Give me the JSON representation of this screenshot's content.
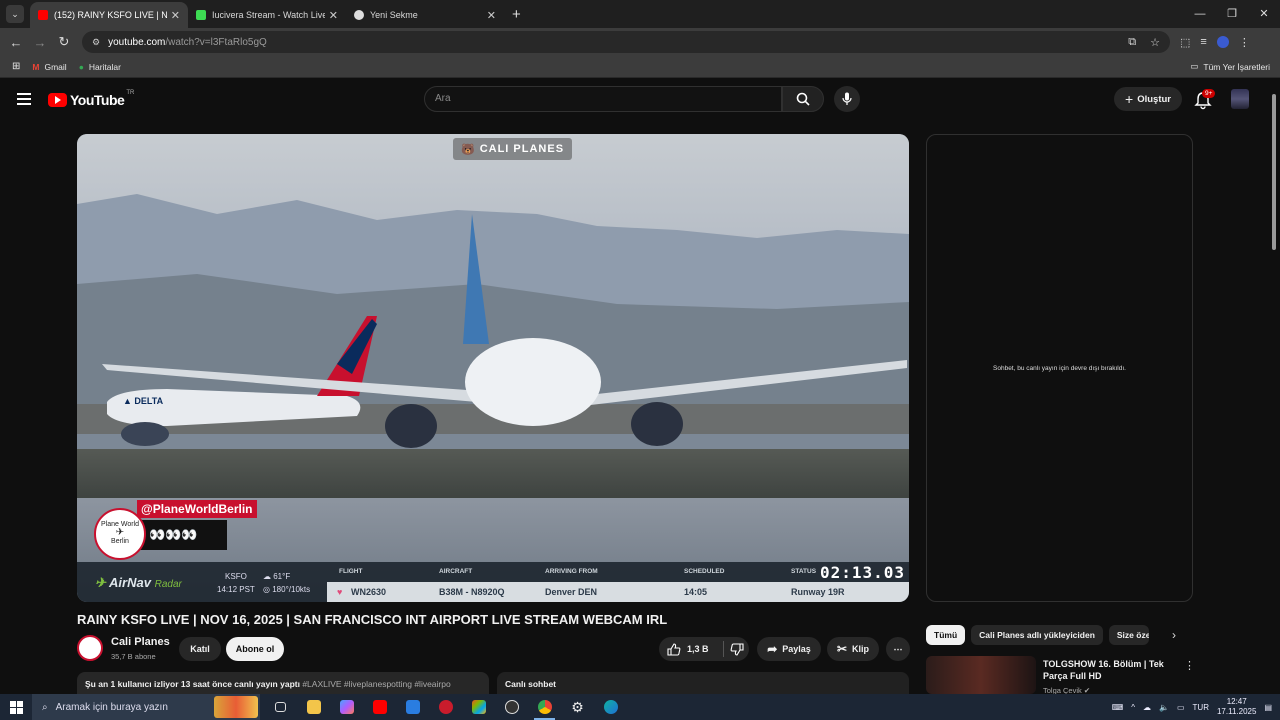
{
  "browser": {
    "tabs": [
      {
        "title": "(152) RAINY KSFO LIVE | NOV 1",
        "favicon_color": "#ff0000",
        "active": true
      },
      {
        "title": "Iucivera Stream - Watch Live on",
        "favicon_color": "#3ddc53",
        "active": false
      },
      {
        "title": "Yeni Sekme",
        "favicon_color": "#dddddd",
        "active": false
      }
    ],
    "url_host": "youtube.com",
    "url_path": "/watch?v=l3FtaRlo5gQ",
    "bookmarks": [
      {
        "label": "Gmail",
        "icon": "gmail-icon"
      },
      {
        "label": "Haritalar",
        "icon": "maps-icon"
      }
    ],
    "all_bookmarks_label": "Tüm Yer İşaretleri"
  },
  "youtube": {
    "logo_text": "YouTube",
    "country_code": "TR",
    "search_placeholder": "Ara",
    "create_label": "Oluştur",
    "notif_badge": "9+"
  },
  "video": {
    "watermark": "CALI PLANES",
    "overlay_handle": "@PlaneWorldBerlin",
    "overlay_emojis": "👀👀👀",
    "overlay_logo_lines": [
      "Plane World",
      "Berlin"
    ],
    "radar_brand": "AirNav",
    "radar_sub": "Radar",
    "airport_code": "KSFO",
    "local_time": "14:12 PST",
    "temperature": "61°F",
    "wind": "180°/10kts",
    "table_headers": [
      "FLIGHT",
      "AIRCRAFT",
      "ARRIVING FROM",
      "SCHEDULED",
      "STATUS"
    ],
    "flight": "WN2630",
    "aircraft": "B38M - N8920Q",
    "arriving_from": "Denver DEN",
    "scheduled": "14:05",
    "status": "Runway 19R",
    "timer": "02:13.03",
    "title": "RAINY KSFO LIVE | NOV 16, 2025 | SAN FRANCISCO INT AIRPORT LIVE STREAM WEBCAM IRL"
  },
  "channel": {
    "name": "Cali Planes",
    "subscribers": "35,7 B abone",
    "join_label": "Katıl",
    "subscribe_label": "Abone ol"
  },
  "actions": {
    "like_count": "1,3 B",
    "share_label": "Paylaş",
    "clip_label": "Klip"
  },
  "description": {
    "stats": "Şu an 1 kullanıcı izliyor  13 saat önce canlı yayın yaptı",
    "tags": "#LAXLIVE #liveplanespotting #liveairpo"
  },
  "chat": {
    "disabled_message": "Sohbet, bu canlı yayın için devre dışı bırakıldı.",
    "bar_label": "Canlı sohbet"
  },
  "recommendations": {
    "chips": [
      "Tümü",
      "Cali Planes adlı yükleyiciden",
      "Size özel"
    ],
    "items": [
      {
        "title": "TOLGSHOW 16. Bölüm | Tek Parça Full HD",
        "channel": "Tolga Çevik"
      }
    ]
  },
  "taskbar": {
    "search_placeholder": "Aramak için buraya yazın",
    "language": "TUR",
    "time": "12:47",
    "date": "17.11.2025"
  }
}
